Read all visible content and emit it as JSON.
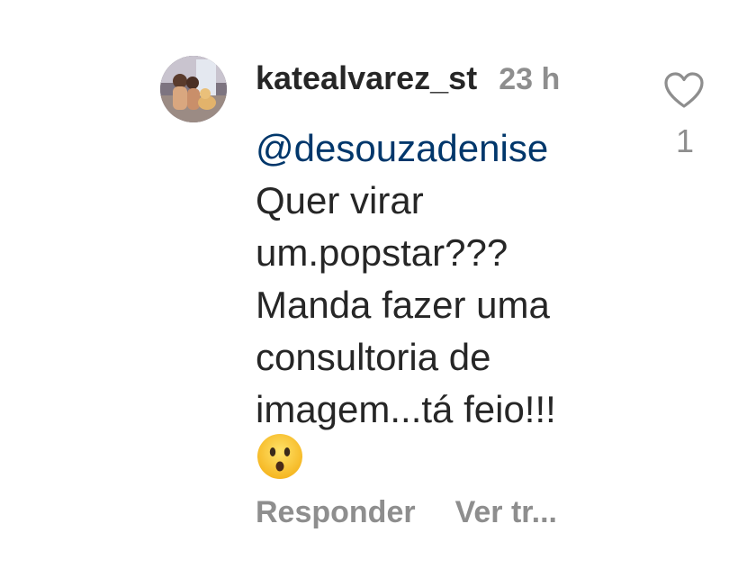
{
  "comment": {
    "username": "katealvarez_st",
    "time": "23 h",
    "mention": "@desouzadenise",
    "lines": [
      "Quer virar",
      "um.popstar???",
      "Manda fazer uma",
      "consultoria de",
      "imagem...tá feio!!!"
    ],
    "emoji": "hushed-face-emoji",
    "like_icon": "heart-outline-icon",
    "like_count": "1",
    "actions": {
      "reply": "Responder",
      "see_translation": "Ver tr..."
    }
  }
}
